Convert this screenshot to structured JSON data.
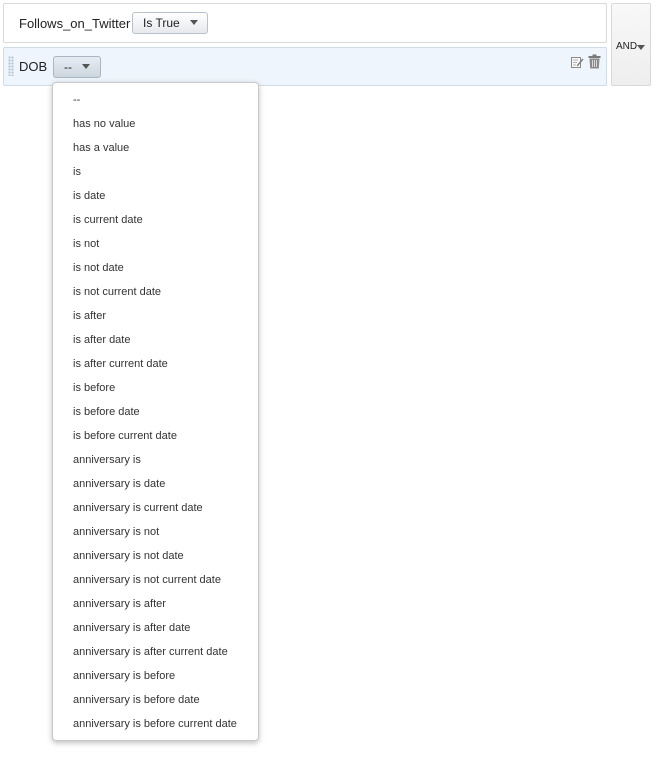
{
  "rules": {
    "twitter": {
      "field": "Follows_on_Twitter",
      "operator": "Is True"
    },
    "dob": {
      "field": "DOB",
      "operator": "--"
    }
  },
  "logic": {
    "label": "AND"
  },
  "icons": {
    "edit": "edit-icon",
    "delete": "trash-icon"
  },
  "dropdown": {
    "items": [
      "--",
      "has no value",
      "has a value",
      "is",
      "is date",
      "is current date",
      "is not",
      "is not date",
      "is not current date",
      "is after",
      "is after date",
      "is after current date",
      "is before",
      "is before date",
      "is before current date",
      "anniversary is",
      "anniversary is date",
      "anniversary is current date",
      "anniversary is not",
      "anniversary is not date",
      "anniversary is not current date",
      "anniversary is after",
      "anniversary is after date",
      "anniversary is after current date",
      "anniversary is before",
      "anniversary is before date",
      "anniversary is before current date"
    ]
  },
  "colors": {
    "selected_row_bg": "#eef5fc",
    "border": "#d9d9d9"
  }
}
